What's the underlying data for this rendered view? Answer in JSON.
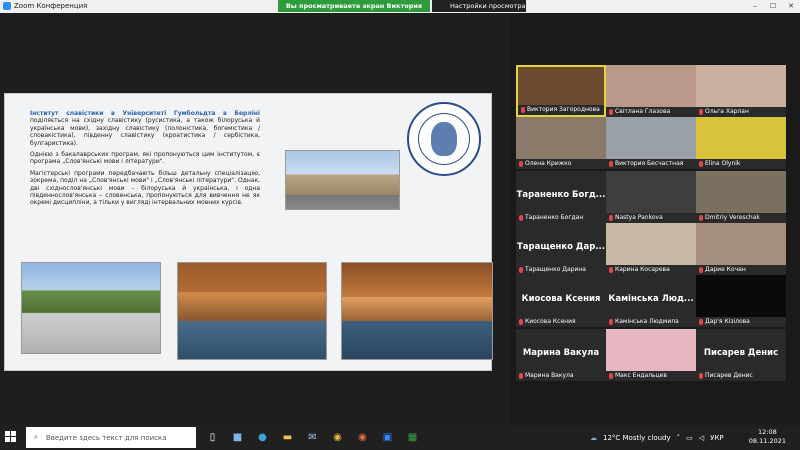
{
  "window": {
    "title": "Zoom Конференция",
    "controls": [
      "–",
      "☐",
      "✕"
    ]
  },
  "share": {
    "banner": "Вы просматриваете экран Виктория Загороднова",
    "settings_label": "Настройки просмотра"
  },
  "slide": {
    "heading": "Інститут славістики в Університеті Гумбольдта в Берліні",
    "p1": "поділяється на східну славістику (русистика, а також білоруська й українська мови), західну славістику (полоністика, богемістика / словакістика), південну славістику (кроатистика / сербістика, булгаристика).",
    "p2": "Однією з бакалаврських програм, які пропонуються цим інститутом, є програма „Слов'янські мови і літератури\".",
    "p3": "Магістерські програми передбачають більш детальну спеціалізацію, зокрема, поділ на „Слов'янські мови\" і „Слов'янські літератури\". Однак, дві східнослов'янські мови – білоруська й українська, і одна південнослов'янська – словенська, пропонуються для вивчення не як окремі дисципліни, а тільки у вигляді інтервальних мовних курсів."
  },
  "participants": [
    {
      "name": "Виктория Загороднова",
      "label": "",
      "video": true,
      "color": "#6b4a2e"
    },
    {
      "name": "Світлана Глазова",
      "label": "",
      "video": true,
      "color": "#b99a8a"
    },
    {
      "name": "Ольга Харлан",
      "label": "",
      "video": true,
      "color": "#c9b0a0"
    },
    {
      "name": "Олена Крижко",
      "label": "",
      "video": true,
      "color": "#8a7a6a"
    },
    {
      "name": "Виктория Бесчастная",
      "label": "",
      "video": true,
      "color": "#9aa0a8"
    },
    {
      "name": "Elina Olynik",
      "label": "",
      "video": true,
      "color": "#d8c43a"
    },
    {
      "name": "Тараненко Богдан",
      "label": "Тараненко Богд...",
      "video": false,
      "color": "#2a2a2a"
    },
    {
      "name": "Nastya Pankova",
      "label": "",
      "video": true,
      "color": "#3e3e3e"
    },
    {
      "name": "Dmitriy Vereschak",
      "label": "",
      "video": true,
      "color": "#7a7060"
    },
    {
      "name": "Таращенко Дарина",
      "label": "Таращенко Дар...",
      "video": false,
      "color": "#2a2a2a"
    },
    {
      "name": "Карина Косарева",
      "label": "",
      "video": true,
      "color": "#c8b8a8"
    },
    {
      "name": "Дарие Кочан",
      "label": "",
      "video": true,
      "color": "#a89080"
    },
    {
      "name": "Киосова Ксения",
      "label": "Киосова Ксения",
      "video": false,
      "color": "#2a2a2a"
    },
    {
      "name": "Камінська Людмила",
      "label": "Камінська Люд...",
      "video": false,
      "color": "#2a2a2a"
    },
    {
      "name": "Дар'я Кізілова",
      "label": "",
      "video": true,
      "color": "#0a0a0a"
    },
    {
      "name": "Марина Вакула",
      "label": "Марина Вакула",
      "video": false,
      "color": "#2a2a2a"
    },
    {
      "name": "Макс Ендальцев",
      "label": "",
      "video": true,
      "color": "#e6b7c0"
    },
    {
      "name": "Писарев Денис",
      "label": "Писарев Денис",
      "video": false,
      "color": "#2a2a2a"
    }
  ],
  "taskbar": {
    "search_placeholder": "Введите здесь текст для поиска",
    "weather": "12°C  Mostly cloudy",
    "lang": "УКР",
    "time": "12:08",
    "date": "08.11.2021"
  }
}
